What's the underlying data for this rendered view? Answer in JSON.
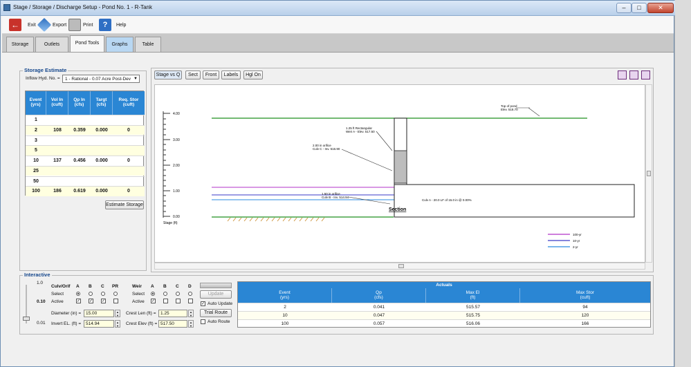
{
  "window": {
    "title": "Stage / Storage / Discharge Setup - Pond No. 1 - R-Tank"
  },
  "toolbar": {
    "exit": "Exit",
    "export": "Export",
    "print": "Print",
    "help": "Help"
  },
  "tabs": [
    "Storage",
    "Outlets",
    "Pond Tools",
    "Graphs",
    "Table"
  ],
  "storage_estimate": {
    "title": "Storage Estimate",
    "inflow_label": "Inflow Hyd. No. =",
    "inflow_value": "1 - Rational - 0.07 Acre Post-Dev",
    "columns": [
      [
        "Event",
        "(yrs)"
      ],
      [
        "Vol In",
        "(cuft)"
      ],
      [
        "Qp In",
        "(cfs)"
      ],
      [
        "Targt",
        "(cfs)"
      ],
      [
        "Req. Stor",
        "(cuft)"
      ]
    ],
    "rows": [
      [
        "1",
        "",
        "",
        "",
        ""
      ],
      [
        "2",
        "108",
        "0.359",
        "0.000",
        "0"
      ],
      [
        "3",
        "",
        "",
        "",
        ""
      ],
      [
        "5",
        "",
        "",
        "",
        ""
      ],
      [
        "10",
        "137",
        "0.456",
        "0.000",
        "0"
      ],
      [
        "25",
        "",
        "",
        "",
        ""
      ],
      [
        "50",
        "",
        "",
        "",
        ""
      ],
      [
        "100",
        "186",
        "0.619",
        "0.000",
        "0"
      ]
    ],
    "estimate_button": "Estimate Storage"
  },
  "chart_buttons": {
    "stage_vs_q": "Stage vs Q",
    "sect": "Sect",
    "front": "Front",
    "labels": "Labels",
    "hgl_on": "Hgl On"
  },
  "plot": {
    "y_ticks": [
      "4.00",
      "3.00",
      "2.00",
      "1.00",
      "0.00"
    ],
    "y_axis_label": "Stage (ft)",
    "top_of_pond": [
      "Top of pond",
      "Elev. 518.70"
    ],
    "weir_label": [
      "1.25 ft Rectangular",
      "Weir A - Elev. 517.50"
    ],
    "orifice_c_label": [
      "2.00 in orifice",
      "Culv C - Inv. 516.90"
    ],
    "orifice_b_label": [
      "1.50 in orifice",
      "Culv B - Inv. 514.94"
    ],
    "culvert_label": "Culv A - 20.0 LF of 15.0 in @ 0.00%",
    "section_label": "Section",
    "legend": [
      {
        "name": "100-yr",
        "color": "#b030c8"
      },
      {
        "name": "10-yr",
        "color": "#3a3ac8"
      },
      {
        "name": "2-yr",
        "color": "#2a8ae0"
      }
    ]
  },
  "interactive": {
    "title": "Interactive",
    "slider_values": [
      "1.0",
      "0.10",
      "0.01"
    ],
    "culv_orif_label": "Culv/Orif",
    "weir_label": "Weir",
    "culv_cols": [
      "A",
      "B",
      "C",
      "PR"
    ],
    "weir_cols": [
      "A",
      "B",
      "C",
      "D"
    ],
    "select_label": "Select",
    "active_label": "Active",
    "diameter_label": "Diameter (in) =",
    "diameter_value": "15.00",
    "invert_label": "Invert EL. (ft) =",
    "invert_value": "514.94",
    "crest_len_label": "Crest Len (ft) =",
    "crest_len_value": "1.25",
    "crest_elev_label": "Crest Elev (ft) =",
    "crest_elev_value": "517.50",
    "update_button": "Update",
    "auto_update_label": "Auto Update",
    "trial_route_button": "Trial Route",
    "auto_route_label": "Auto Route"
  },
  "actuals": {
    "title": "Actuals",
    "columns": [
      [
        "Event",
        "(yrs)"
      ],
      [
        "Qp",
        "(cfs)"
      ],
      [
        "Max El",
        "(ft)"
      ],
      [
        "Max Stor",
        "(cuft)"
      ]
    ],
    "rows": [
      [
        "2",
        "0.041",
        "515.57",
        "94"
      ],
      [
        "10",
        "0.047",
        "515.75",
        "120"
      ],
      [
        "100",
        "0.057",
        "516.06",
        "166"
      ]
    ]
  }
}
